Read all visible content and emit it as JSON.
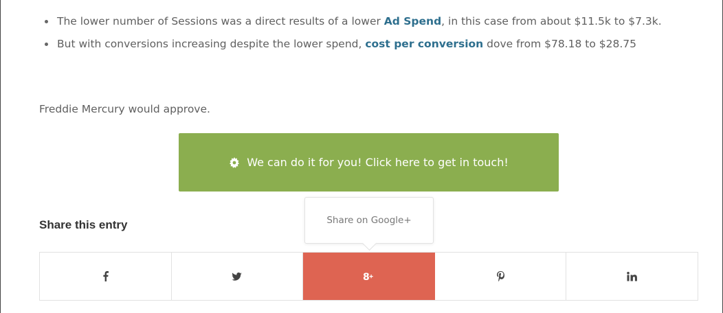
{
  "article": {
    "bullets": [
      {
        "before": "The lower number of Sessions was a direct results of a lower ",
        "link": "Ad Spend",
        "after": ", in this case from about $11.5k to $7.3k."
      },
      {
        "before": "But with conversions increasing despite the lower spend, ",
        "link": "cost per conversion",
        "after": " dove from $78.18 to $28.75"
      }
    ],
    "closing": "Freddie Mercury would approve."
  },
  "cta": {
    "label": "We can do it for you! Click here to get in touch!",
    "icon": "gear-icon"
  },
  "share": {
    "title": "Share this entry",
    "tooltip": "Share on Google+",
    "buttons": [
      {
        "icon": "facebook-icon"
      },
      {
        "icon": "twitter-icon"
      },
      {
        "icon": "google-plus-icon",
        "active": true
      },
      {
        "icon": "pinterest-icon"
      },
      {
        "icon": "linkedin-icon"
      }
    ],
    "active_color": "#de6452"
  },
  "colors": {
    "link": "#2e6f8e",
    "cta_background": "#8bae4f"
  }
}
